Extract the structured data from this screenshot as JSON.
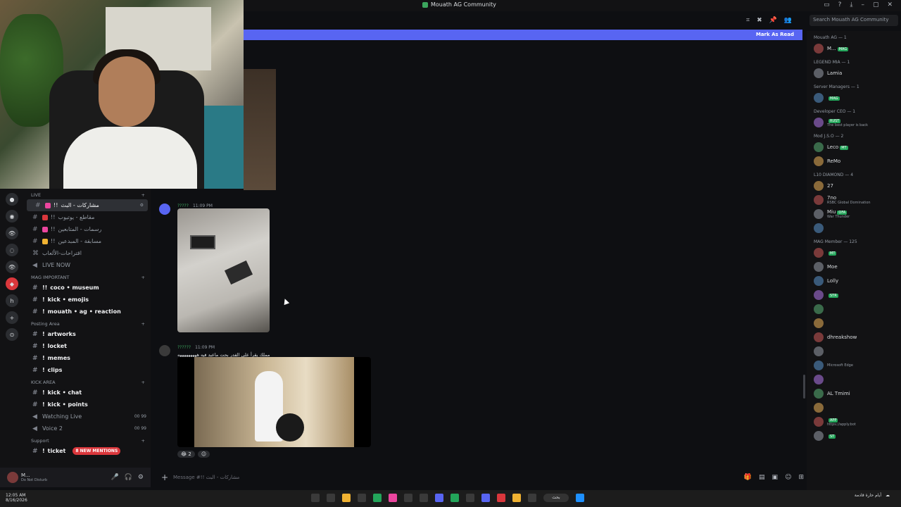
{
  "window": {
    "title": "Mouath AG Community",
    "search_placeholder": "Search Mouath AG Community"
  },
  "banner": {
    "mark_as_read": "Mark As Read"
  },
  "sidebar": {
    "live_category": "LIVE",
    "channels_live": [
      {
        "label": "مشاركات - البث",
        "prefix": "!!",
        "active": true
      },
      {
        "label": "مقاطع - يوتيوب",
        "prefix": "!!"
      },
      {
        "label": "رسمات - المتابعين",
        "prefix": "!!"
      },
      {
        "label": "مسابقة - المبدعين",
        "prefix": "!!"
      },
      {
        "label": "اقتراحات-الألعاب",
        "prefix": ""
      },
      {
        "label": "LIVE NOW",
        "prefix": ""
      }
    ],
    "cat_important": "MAG IMPORTANT",
    "channels_important": [
      {
        "label": "coco • museum",
        "prefix": "!!"
      },
      {
        "label": "kick • emojis",
        "prefix": "!"
      },
      {
        "label": "mouath • ag • reaction",
        "prefix": "!"
      }
    ],
    "cat_posting": "Posting Area",
    "channels_posting": [
      {
        "label": "artworks",
        "prefix": "!"
      },
      {
        "label": "locket",
        "prefix": "!"
      },
      {
        "label": "memes",
        "prefix": "!"
      },
      {
        "label": "clips",
        "prefix": "!"
      }
    ],
    "cat_kick": "KICK AREA",
    "channels_kick": [
      {
        "label": "kick • chat",
        "prefix": "!"
      },
      {
        "label": "kick • points",
        "prefix": "!"
      },
      {
        "label": "Watching Live",
        "prefix": "",
        "meta": "00 99"
      },
      {
        "label": "Voice 2",
        "prefix": "",
        "meta": "00 99"
      }
    ],
    "cat_support": "Support",
    "ticket": {
      "label": "ticket",
      "prefix": "!",
      "badge": "8 NEW MENTIONS"
    },
    "user": {
      "name": "M...",
      "status": "Do Not Disturb"
    }
  },
  "messages": [
    {
      "name": "?????",
      "time": "11:09 PM"
    },
    {
      "name": "??????",
      "time": "11:09 PM",
      "text": "مملك يقرأ على الفدر بحت ماعبد فيه هههههههههه"
    }
  ],
  "reactions": [
    {
      "count": "2"
    }
  ],
  "composer": {
    "placeholder": "Message #!! مشاركات - البث"
  },
  "members": [
    {
      "cat": "Mouath AG — 1",
      "items": [
        {
          "name": "M...",
          "tag": "MAG"
        }
      ]
    },
    {
      "cat": "LEGEND MIA — 1",
      "items": [
        {
          "name": "Lamia",
          "sub": ""
        }
      ]
    },
    {
      "cat": "Server Managers — 1",
      "items": [
        {
          "name": "",
          "tag": "MAG"
        }
      ]
    },
    {
      "cat": "Developer CEO — 1",
      "items": [
        {
          "name": "",
          "tag": "RUST",
          "sub": "The best player is back"
        }
      ]
    },
    {
      "cat": "Mod J.S.O — 2",
      "items": [
        {
          "name": "Leco",
          "tag": "MT"
        },
        {
          "name": "ReMo"
        }
      ]
    },
    {
      "cat": "L10 DIAMOND — 4",
      "items": [
        {
          "name": "27"
        },
        {
          "name": "7no",
          "sub": "RSBC Global Domination"
        },
        {
          "name": "Miu",
          "tag": "OFA",
          "sub": "War Thunder"
        },
        {
          "name": ""
        }
      ]
    },
    {
      "cat": "MAG Member — 125",
      "items": [
        {
          "name": "",
          "tag": "MT"
        },
        {
          "name": "Moe"
        },
        {
          "name": "Lolly"
        },
        {
          "name": "",
          "tag": "STR"
        },
        {
          "name": ""
        },
        {
          "name": ""
        },
        {
          "name": "dhreakshow"
        },
        {
          "name": ""
        },
        {
          "name": "",
          "sub": "Microsoft Edge"
        },
        {
          "name": ""
        },
        {
          "name": "AL Tmimi"
        },
        {
          "name": ""
        },
        {
          "name": "",
          "tag": "APP",
          "sub": "https://apply.bot"
        },
        {
          "name": "",
          "tag": "ST"
        }
      ]
    }
  ],
  "taskbar": {
    "time": "12:05 AM",
    "date": "8/16/2026",
    "search": "بحث",
    "weather": "أيام حارة قادمة"
  },
  "colors": {
    "accent": "#5865f2",
    "online": "#23a55a",
    "mention": "#da373c"
  }
}
